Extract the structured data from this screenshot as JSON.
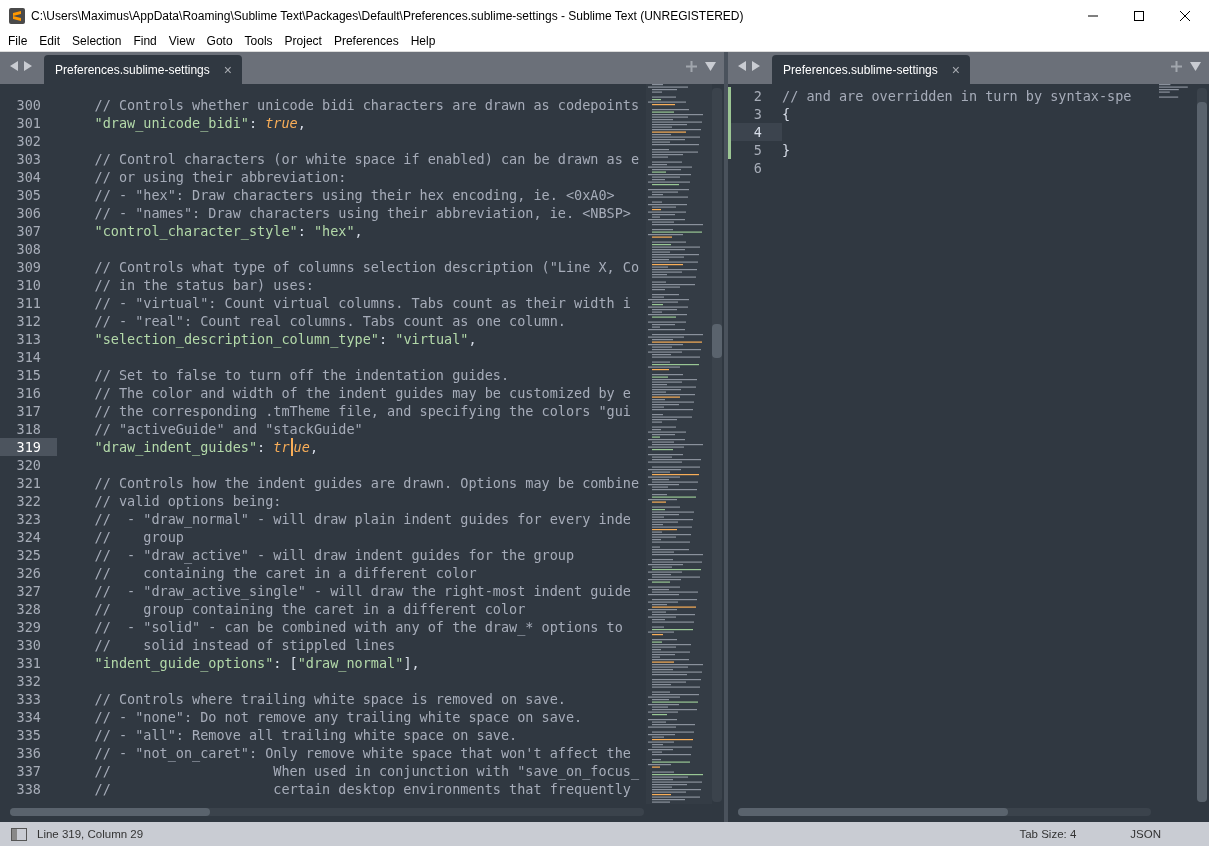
{
  "window": {
    "title": "C:\\Users\\Maximus\\AppData\\Roaming\\Sublime Text\\Packages\\Default\\Preferences.sublime-settings - Sublime Text (UNREGISTERED)"
  },
  "menu": [
    "File",
    "Edit",
    "Selection",
    "Find",
    "View",
    "Goto",
    "Tools",
    "Project",
    "Preferences",
    "Help"
  ],
  "panes": [
    {
      "tabs": [
        {
          "label": "Preferences.sublime-settings",
          "selected": true,
          "close": "×"
        }
      ],
      "lines": [
        {
          "number": "300",
          "current": false,
          "modified": false,
          "tokens": [
            {
              "kind": "comment",
              "text": "    // Controls whether unicode bidi characters are drawn as codepoints"
            }
          ]
        },
        {
          "number": "301",
          "current": false,
          "modified": false,
          "tokens": [
            {
              "kind": "key",
              "text": "    \"draw_unicode_bidi\""
            },
            {
              "kind": "punct",
              "text": ": "
            },
            {
              "kind": "bool",
              "text": "true"
            },
            {
              "kind": "punct",
              "text": ","
            }
          ]
        },
        {
          "number": "302",
          "current": false,
          "modified": false
        },
        {
          "number": "303",
          "current": false,
          "modified": false,
          "tokens": [
            {
              "kind": "comment",
              "text": "    // Control characters (or white space if enabled) can be drawn as e"
            }
          ]
        },
        {
          "number": "304",
          "current": false,
          "modified": false,
          "tokens": [
            {
              "kind": "comment",
              "text": "    // or using their abbreviation:"
            }
          ]
        },
        {
          "number": "305",
          "current": false,
          "modified": false,
          "tokens": [
            {
              "kind": "comment",
              "text": "    // - \"hex\": Draw characters using their hex encoding, ie. <0xA0>"
            }
          ]
        },
        {
          "number": "306",
          "current": false,
          "modified": false,
          "tokens": [
            {
              "kind": "comment",
              "text": "    // - \"names\": Draw characters using their abbreviation, ie. <NBSP>"
            }
          ]
        },
        {
          "number": "307",
          "current": false,
          "modified": false,
          "tokens": [
            {
              "kind": "key",
              "text": "    \"control_character_style\""
            },
            {
              "kind": "punct",
              "text": ": "
            },
            {
              "kind": "string",
              "text": "\"hex\""
            },
            {
              "kind": "punct",
              "text": ","
            }
          ]
        },
        {
          "number": "308",
          "current": false,
          "modified": false
        },
        {
          "number": "309",
          "current": false,
          "modified": false,
          "tokens": [
            {
              "kind": "comment",
              "text": "    // Controls what type of columns selection description (\"Line X, Co"
            }
          ]
        },
        {
          "number": "310",
          "current": false,
          "modified": false,
          "tokens": [
            {
              "kind": "comment",
              "text": "    // in the status bar) uses:"
            }
          ]
        },
        {
          "number": "311",
          "current": false,
          "modified": false,
          "tokens": [
            {
              "kind": "comment",
              "text": "    // - \"virtual\": Count virtual columns. Tabs count as their width i"
            }
          ]
        },
        {
          "number": "312",
          "current": false,
          "modified": false,
          "tokens": [
            {
              "kind": "comment",
              "text": "    // - \"real\": Count real columns. Tabs count as one column."
            }
          ]
        },
        {
          "number": "313",
          "current": false,
          "modified": false,
          "tokens": [
            {
              "kind": "key",
              "text": "    \"selection_description_column_type\""
            },
            {
              "kind": "punct",
              "text": ": "
            },
            {
              "kind": "string",
              "text": "\"virtual\""
            },
            {
              "kind": "punct",
              "text": ","
            }
          ]
        },
        {
          "number": "314",
          "current": false,
          "modified": false
        },
        {
          "number": "315",
          "current": false,
          "modified": false,
          "tokens": [
            {
              "kind": "comment",
              "text": "    // Set to false to turn off the indentation guides."
            }
          ]
        },
        {
          "number": "316",
          "current": false,
          "modified": false,
          "tokens": [
            {
              "kind": "comment",
              "text": "    // The color and width of the indent guides may be customized by e"
            }
          ]
        },
        {
          "number": "317",
          "current": false,
          "modified": false,
          "tokens": [
            {
              "kind": "comment",
              "text": "    // the corresponding .tmTheme file, and specifying the colors \"gui"
            }
          ]
        },
        {
          "number": "318",
          "current": false,
          "modified": false,
          "tokens": [
            {
              "kind": "comment",
              "text": "    // \"activeGuide\" and \"stackGuide\""
            }
          ]
        },
        {
          "number": "319",
          "current": true,
          "modified": false,
          "tokens": [
            {
              "kind": "key",
              "text": "    \"draw_indent_guides\""
            },
            {
              "kind": "punct",
              "text": ": "
            },
            {
              "kind": "bool",
              "text": "tr"
            },
            {
              "kind": "caret"
            },
            {
              "kind": "bool",
              "text": "ue"
            },
            {
              "kind": "punct",
              "text": ","
            }
          ]
        },
        {
          "number": "320",
          "current": false,
          "modified": false
        },
        {
          "number": "321",
          "current": false,
          "modified": false,
          "tokens": [
            {
              "kind": "comment",
              "text": "    // Controls how the indent guides are drawn. Options may be combine"
            }
          ]
        },
        {
          "number": "322",
          "current": false,
          "modified": false,
          "tokens": [
            {
              "kind": "comment",
              "text": "    // valid options being:"
            }
          ]
        },
        {
          "number": "323",
          "current": false,
          "modified": false,
          "tokens": [
            {
              "kind": "comment",
              "text": "    //  - \"draw_normal\" - will draw plain indent guides for every inde"
            }
          ]
        },
        {
          "number": "324",
          "current": false,
          "modified": false,
          "tokens": [
            {
              "kind": "comment",
              "text": "    //    group"
            }
          ]
        },
        {
          "number": "325",
          "current": false,
          "modified": false,
          "tokens": [
            {
              "kind": "comment",
              "text": "    //  - \"draw_active\" - will draw indent guides for the group"
            }
          ]
        },
        {
          "number": "326",
          "current": false,
          "modified": false,
          "tokens": [
            {
              "kind": "comment",
              "text": "    //    containing the caret in a different color"
            }
          ]
        },
        {
          "number": "327",
          "current": false,
          "modified": false,
          "tokens": [
            {
              "kind": "comment",
              "text": "    //  - \"draw_active_single\" - will draw the right-most indent guide"
            }
          ]
        },
        {
          "number": "328",
          "current": false,
          "modified": false,
          "tokens": [
            {
              "kind": "comment",
              "text": "    //    group containing the caret in a different color"
            }
          ]
        },
        {
          "number": "329",
          "current": false,
          "modified": false,
          "tokens": [
            {
              "kind": "comment",
              "text": "    //  - \"solid\" - can be combined with any of the draw_* options to"
            }
          ]
        },
        {
          "number": "330",
          "current": false,
          "modified": false,
          "tokens": [
            {
              "kind": "comment",
              "text": "    //    solid instead of stippled lines"
            }
          ]
        },
        {
          "number": "331",
          "current": false,
          "modified": false,
          "tokens": [
            {
              "kind": "key",
              "text": "    \"indent_guide_options\""
            },
            {
              "kind": "punct",
              "text": ": ["
            },
            {
              "kind": "string",
              "text": "\"draw_normal\""
            },
            {
              "kind": "punct",
              "text": "],"
            }
          ]
        },
        {
          "number": "332",
          "current": false,
          "modified": false
        },
        {
          "number": "333",
          "current": false,
          "modified": false,
          "tokens": [
            {
              "kind": "comment",
              "text": "    // Controls where trailing white space is removed on save."
            }
          ]
        },
        {
          "number": "334",
          "current": false,
          "modified": false,
          "tokens": [
            {
              "kind": "comment",
              "text": "    // - \"none\": Do not remove any trailing white space on save."
            }
          ]
        },
        {
          "number": "335",
          "current": false,
          "modified": false,
          "tokens": [
            {
              "kind": "comment",
              "text": "    // - \"all\": Remove all trailing white space on save."
            }
          ]
        },
        {
          "number": "336",
          "current": false,
          "modified": false,
          "tokens": [
            {
              "kind": "comment",
              "text": "    // - \"not_on_caret\": Only remove white space that won't affect the"
            }
          ]
        },
        {
          "number": "337",
          "current": false,
          "modified": false,
          "tokens": [
            {
              "kind": "comment",
              "text": "    //                    When used in conjunction with \"save_on_focus_"
            }
          ]
        },
        {
          "number": "338",
          "current": false,
          "modified": false,
          "tokens": [
            {
              "kind": "comment",
              "text": "    //                    certain desktop environments that frequently"
            }
          ]
        }
      ]
    },
    {
      "tabs": [
        {
          "label": "Preferences.sublime-settings",
          "selected": true,
          "close": "×"
        }
      ],
      "lines": [
        {
          "number": "2",
          "current": false,
          "modified": true,
          "tokens": [
            {
              "kind": "comment",
              "text": "// and are overridden in turn by syntax-spe"
            }
          ]
        },
        {
          "number": "3",
          "current": false,
          "modified": true,
          "tokens": [
            {
              "kind": "punct",
              "text": "{"
            }
          ]
        },
        {
          "number": "4",
          "current": true,
          "modified": true
        },
        {
          "number": "5",
          "current": false,
          "modified": true,
          "tokens": [
            {
              "kind": "punct",
              "text": "}"
            }
          ]
        },
        {
          "number": "6",
          "current": false,
          "modified": false
        }
      ]
    }
  ],
  "status_bar": {
    "position": "Line 319, Column 29",
    "tab_size": "Tab Size: 4",
    "syntax": "JSON"
  }
}
